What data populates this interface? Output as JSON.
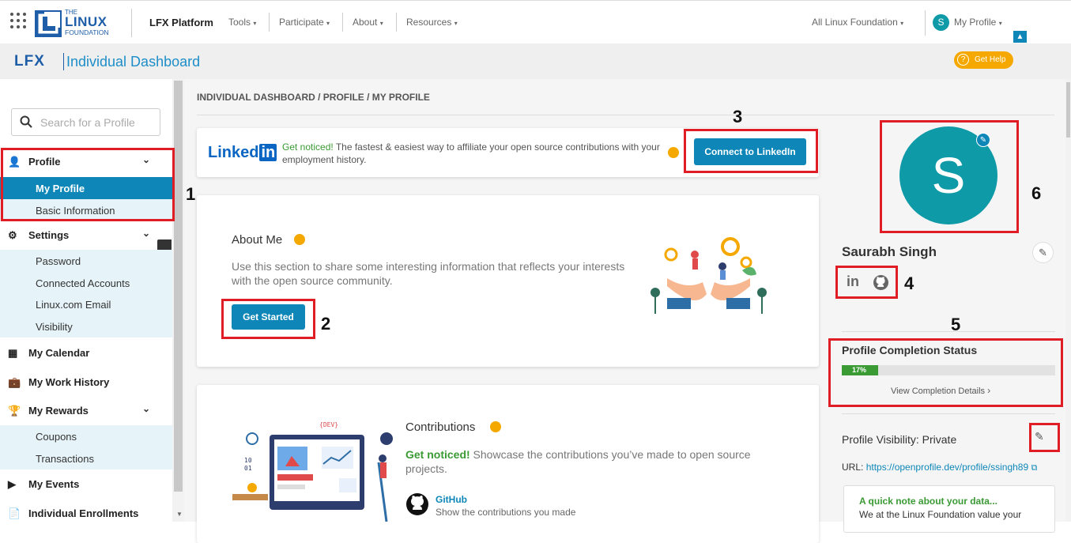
{
  "topnav": {
    "logo_small": "THE",
    "logo_main": "LINUX",
    "logo_sub": "FOUNDATION",
    "platform": "LFX Platform",
    "links": [
      "Tools",
      "Participate",
      "About",
      "Resources"
    ],
    "all_lf": "All Linux Foundation",
    "profile_initial": "S",
    "my_profile": "My Profile"
  },
  "subheader": {
    "brand": "LFX",
    "title": "Individual Dashboard",
    "help": "Get Help"
  },
  "sidebar": {
    "search_placeholder": "Search for a Profile",
    "profile": "Profile",
    "my_profile": "My Profile",
    "basic_info": "Basic Information",
    "settings": "Settings",
    "password": "Password",
    "connected": "Connected Accounts",
    "lfemail": "Linux.com Email",
    "visibility": "Visibility",
    "calendar": "My Calendar",
    "work": "My Work History",
    "rewards": "My Rewards",
    "coupons": "Coupons",
    "transactions": "Transactions",
    "events": "My Events",
    "enrollments": "Individual Enrollments"
  },
  "breadcrumb": "INDIVIDUAL DASHBOARD / PROFILE / MY PROFILE",
  "linkedin_banner": {
    "logo": "Linked",
    "logo_in": "in",
    "notice": "Get noticed!",
    "text": " The fastest & easiest way to affiliate your open source contributions with your employment history.",
    "button": "Connect to LinkedIn"
  },
  "about": {
    "title": "About Me",
    "text": "Use this section to share some interesting information that reflects your interests with the open source community.",
    "button": "Get Started"
  },
  "contributions": {
    "title": "Contributions",
    "notice": "Get noticed!",
    "text": " Showcase the contributions you’ve made to open source projects.",
    "github": "GitHub",
    "github_text": "Show the contributions you made"
  },
  "profile_panel": {
    "initial": "S",
    "name": "Saurabh Singh",
    "completion_title": "Profile Completion Status",
    "completion_pct": "17%",
    "completion_value": 0.17,
    "completion_details": "View Completion Details",
    "visibility": "Profile Visibility: Private",
    "url_label": "URL: ",
    "url": "https://openprofile.dev/profile/ssingh89",
    "note_title": "A quick note about your data...",
    "note_text": "We at the Linux Foundation value your"
  },
  "markers": [
    "1",
    "2",
    "3",
    "4",
    "5",
    "6"
  ],
  "colors": {
    "accent": "#0e87b8",
    "warning": "#f5a800",
    "highlight": "#e01d25",
    "progress": "#3a9a34",
    "avatar": "#0e9aa7"
  }
}
